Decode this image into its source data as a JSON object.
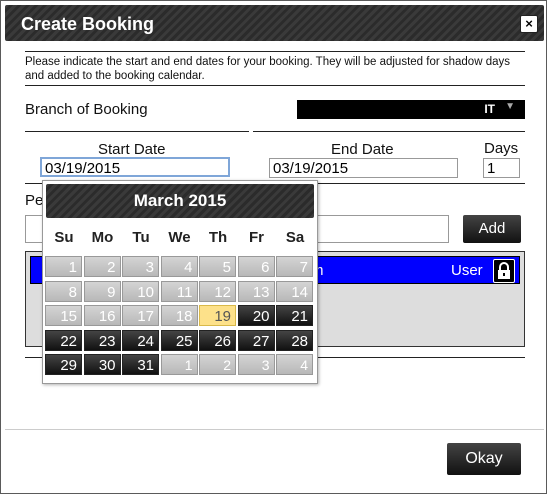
{
  "dialog": {
    "title": "Create Booking",
    "close_label": "×",
    "intro": "Please indicate the start and end dates for your booking. They will be adjusted for shadow days and added to the booking calendar."
  },
  "branch": {
    "label": "Branch of Booking",
    "value": "IT",
    "chevron": "▼"
  },
  "dates": {
    "start_label": "Start Date",
    "start_value": "03/19/2015",
    "end_label": "End Date",
    "end_value": "03/19/2015",
    "days_label": "Days",
    "days_value": "1"
  },
  "people": {
    "label_partial": "Pe",
    "add_label": "Add"
  },
  "list": {
    "row_name_partial": "m",
    "row_role": "User",
    "lock_icon": "lock-icon"
  },
  "footer": {
    "okay_label": "Okay"
  },
  "calendar": {
    "month_title": "March 2015",
    "weekdays": [
      "Su",
      "Mo",
      "Tu",
      "We",
      "Th",
      "Fr",
      "Sa"
    ],
    "weeks": [
      [
        {
          "d": "1",
          "s": "gray"
        },
        {
          "d": "2",
          "s": "gray"
        },
        {
          "d": "3",
          "s": "gray"
        },
        {
          "d": "4",
          "s": "gray"
        },
        {
          "d": "5",
          "s": "gray"
        },
        {
          "d": "6",
          "s": "gray"
        },
        {
          "d": "7",
          "s": "gray"
        }
      ],
      [
        {
          "d": "8",
          "s": "gray"
        },
        {
          "d": "9",
          "s": "gray"
        },
        {
          "d": "10",
          "s": "gray"
        },
        {
          "d": "11",
          "s": "gray"
        },
        {
          "d": "12",
          "s": "gray"
        },
        {
          "d": "13",
          "s": "gray"
        },
        {
          "d": "14",
          "s": "gray"
        }
      ],
      [
        {
          "d": "15",
          "s": "gray"
        },
        {
          "d": "16",
          "s": "gray"
        },
        {
          "d": "17",
          "s": "gray"
        },
        {
          "d": "18",
          "s": "gray"
        },
        {
          "d": "19",
          "s": "today"
        },
        {
          "d": "20",
          "s": "dark"
        },
        {
          "d": "21",
          "s": "dark"
        }
      ],
      [
        {
          "d": "22",
          "s": "dark"
        },
        {
          "d": "23",
          "s": "dark"
        },
        {
          "d": "24",
          "s": "dark"
        },
        {
          "d": "25",
          "s": "dark"
        },
        {
          "d": "26",
          "s": "dark"
        },
        {
          "d": "27",
          "s": "dark"
        },
        {
          "d": "28",
          "s": "dark"
        }
      ],
      [
        {
          "d": "29",
          "s": "dark"
        },
        {
          "d": "30",
          "s": "dark"
        },
        {
          "d": "31",
          "s": "dark"
        },
        {
          "d": "1",
          "s": "other"
        },
        {
          "d": "2",
          "s": "other"
        },
        {
          "d": "3",
          "s": "other"
        },
        {
          "d": "4",
          "s": "other"
        }
      ]
    ]
  }
}
